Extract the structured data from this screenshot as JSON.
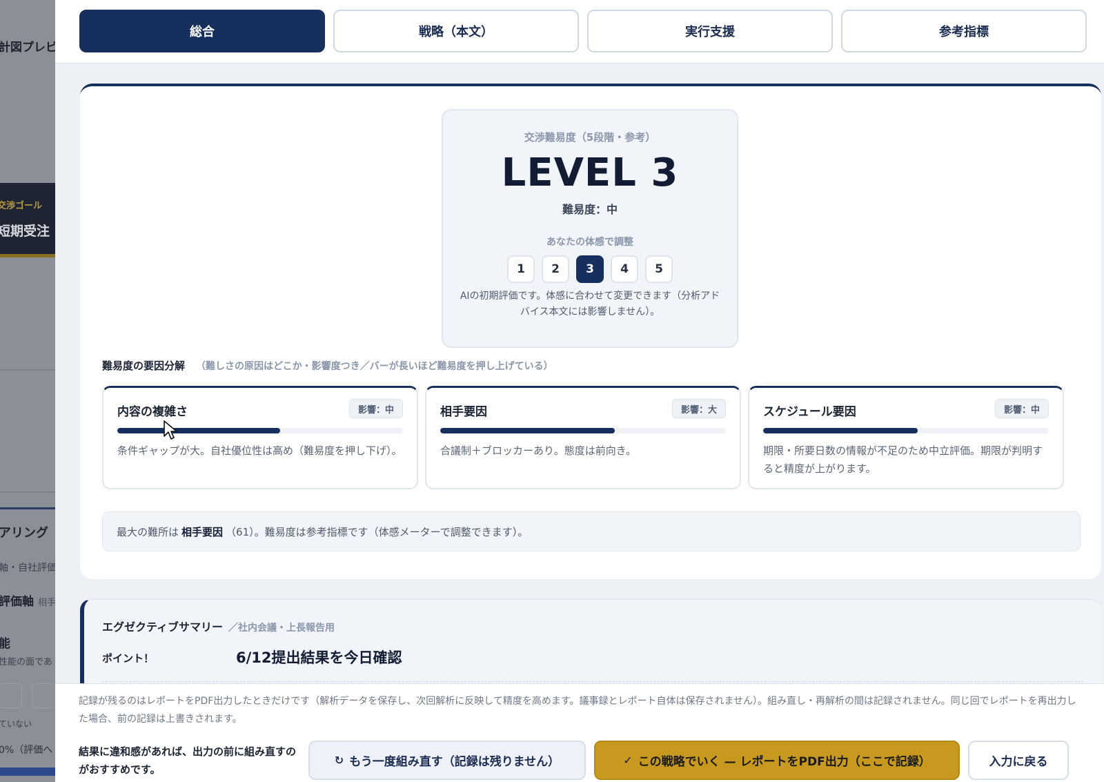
{
  "background": {
    "preview_title": "計図プレビ",
    "goal_label": "交渉ゴール",
    "goal_value": "短期受注",
    "hearing": "アリング",
    "axis_text": "軸・自社評価",
    "eval_axis": "評価軸",
    "eval_axis_sub": "相手",
    "function": "能",
    "function_sub": "性能の面であ",
    "not_yet": "ていない",
    "percent": "0%（評価へ"
  },
  "tabs": [
    {
      "label": "総合",
      "active": true
    },
    {
      "label": "戦略（本文）",
      "active": false
    },
    {
      "label": "実行支援",
      "active": false
    },
    {
      "label": "参考指標",
      "active": false
    }
  ],
  "level": {
    "caption": "交渉難易度（5段階・参考）",
    "value": "LEVEL 3",
    "sub": "難易度：中",
    "adjust_label": "あなたの体感で調整",
    "steps": [
      "1",
      "2",
      "3",
      "4",
      "5"
    ],
    "selected": 3,
    "note": "AIの初期評価です。体感に合わせて変更できます（分析アドバイス本文には影響しません）。"
  },
  "factors": {
    "heading": "難易度の要因分解",
    "heading_sub": "（難しさの原因はどこか・影響度つき／バーが長いほど難易度を押し上げている）",
    "items": [
      {
        "title": "内容の複雑さ",
        "impact": "影響：中",
        "level": 0.57,
        "desc": "条件ギャップが大。自社優位性は高め（難易度を押し下げ）。"
      },
      {
        "title": "相手要因",
        "impact": "影響：大",
        "level": 0.61,
        "desc": "合議制＋ブロッカーあり。態度は前向き。"
      },
      {
        "title": "スケジュール要因",
        "impact": "影響：中",
        "level": 0.54,
        "desc": "期限・所要日数の情報が不足のため中立評価。期限が判明すると精度が上がります。"
      }
    ]
  },
  "summary": {
    "prefix": "最大の難所は",
    "highlight": "相手要因",
    "suffix": "（61）。難易度は参考指標です（体感メーターで調整できます）。"
  },
  "executive": {
    "title": "エグゼクティブサマリー",
    "title_sub": "／社内会議・上長報告用",
    "point_label": "ポイント！",
    "point_value": "6/12提出結果を今日確認"
  },
  "footer": {
    "note": "記録が残るのはレポートをPDF出力したときだけです（解析データを保存し、次回解析に反映して精度を高めます。議事録とレポート自体は保存されません）。組み直し・再解析の間は記録されません。同じ回でレポートを再出力した場合、前の記録は上書きされます。",
    "hint": "結果に違和感があれば、出力の前に組み直すのがおすすめです。",
    "redo_icon": "↻",
    "redo_label": "もう一度組み直す（記録は残りません）",
    "pdf_icon": "✓",
    "pdf_label": "この戦略でいく — レポートをPDF出力（ここで記録）",
    "back_label": "入力に戻る"
  },
  "colors": {
    "navy": "#162f5c",
    "gold": "#c79a1f",
    "panel": "#edf1f6"
  }
}
